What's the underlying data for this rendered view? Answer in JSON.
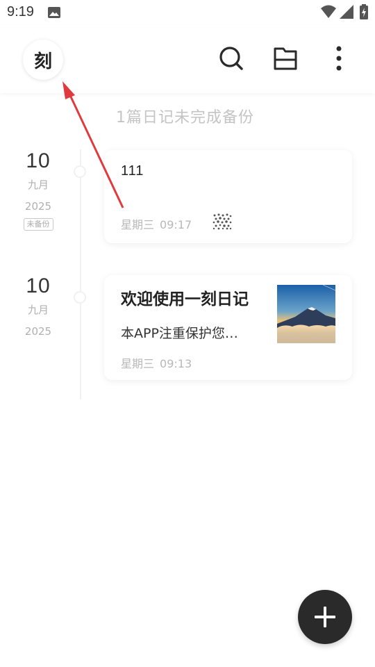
{
  "status_bar": {
    "time": "9:19",
    "icons": [
      "image-icon",
      "wifi-icon",
      "signal-icon",
      "battery-charging-icon"
    ]
  },
  "header": {
    "logo_char": "刻",
    "icons": [
      "search-icon",
      "folder-icon",
      "more-vertical-icon"
    ]
  },
  "notice": {
    "text": "1篇日记未完成备份"
  },
  "entries": [
    {
      "day": "10",
      "month": "九月",
      "year": "2025",
      "tag": "未备份",
      "title": "111",
      "excerpt": "",
      "weekday": "星期三",
      "time": "09:17",
      "weather_icon": "hail-icon"
    },
    {
      "day": "10",
      "month": "九月",
      "year": "2025",
      "tag": "",
      "title": "欢迎使用一刻日记",
      "excerpt": "本APP注重保护您…",
      "weekday": "星期三",
      "time": "09:13",
      "thumbnail": "mountain-sunrise-image"
    }
  ],
  "fab": {
    "icon": "plus-icon"
  },
  "colors": {
    "annotation_arrow": "#e0393e",
    "fab_bg": "#2a2a2a",
    "muted_text": "#b8b8b8"
  }
}
